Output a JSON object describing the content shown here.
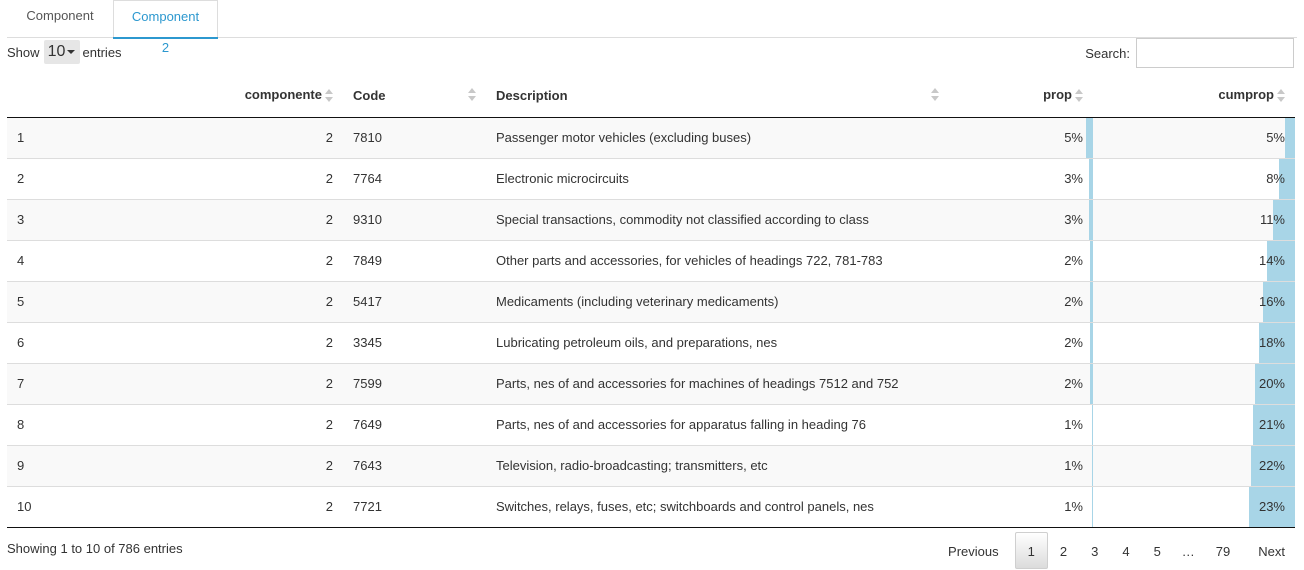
{
  "tabs": [
    {
      "label": "Component 1",
      "active": false
    },
    {
      "label": "Component 2",
      "active": true
    }
  ],
  "length": {
    "prefix": "Show",
    "value": "10",
    "suffix": "entries"
  },
  "search": {
    "label": "Search:",
    "value": "",
    "placeholder": ""
  },
  "table": {
    "headers": {
      "index": "",
      "componente": "componente",
      "code": "Code",
      "description": "Description",
      "prop": "prop",
      "cumprop": "cumprop"
    },
    "rows": [
      {
        "index": "1",
        "componente": "2",
        "code": "7810",
        "description": "Passenger motor vehicles (excluding buses)",
        "prop": "5%",
        "prop_fraction": 0.05,
        "cumprop": "5%",
        "cumprop_fraction": 0.05
      },
      {
        "index": "2",
        "componente": "2",
        "code": "7764",
        "description": "Electronic microcircuits",
        "prop": "3%",
        "prop_fraction": 0.03,
        "cumprop": "8%",
        "cumprop_fraction": 0.08
      },
      {
        "index": "3",
        "componente": "2",
        "code": "9310",
        "description": "Special transactions, commodity not classified according to class",
        "prop": "3%",
        "prop_fraction": 0.03,
        "cumprop": "11%",
        "cumprop_fraction": 0.11
      },
      {
        "index": "4",
        "componente": "2",
        "code": "7849",
        "description": "Other parts and accessories, for vehicles of headings 722, 781-783",
        "prop": "2%",
        "prop_fraction": 0.02,
        "cumprop": "14%",
        "cumprop_fraction": 0.14
      },
      {
        "index": "5",
        "componente": "2",
        "code": "5417",
        "description": "Medicaments (including veterinary medicaments)",
        "prop": "2%",
        "prop_fraction": 0.02,
        "cumprop": "16%",
        "cumprop_fraction": 0.16
      },
      {
        "index": "6",
        "componente": "2",
        "code": "3345",
        "description": "Lubricating petroleum oils, and preparations, nes",
        "prop": "2%",
        "prop_fraction": 0.02,
        "cumprop": "18%",
        "cumprop_fraction": 0.18
      },
      {
        "index": "7",
        "componente": "2",
        "code": "7599",
        "description": "Parts, nes of and accessories for machines of headings 7512 and 752",
        "prop": "2%",
        "prop_fraction": 0.02,
        "cumprop": "20%",
        "cumprop_fraction": 0.2
      },
      {
        "index": "8",
        "componente": "2",
        "code": "7649",
        "description": "Parts, nes of and accessories for apparatus falling in heading 76",
        "prop": "1%",
        "prop_fraction": 0.01,
        "cumprop": "21%",
        "cumprop_fraction": 0.21
      },
      {
        "index": "9",
        "componente": "2",
        "code": "7643",
        "description": "Television, radio-broadcasting; transmitters, etc",
        "prop": "1%",
        "prop_fraction": 0.01,
        "cumprop": "22%",
        "cumprop_fraction": 0.22
      },
      {
        "index": "10",
        "componente": "2",
        "code": "7721",
        "description": "Switches, relays, fuses, etc; switchboards and control panels, nes",
        "prop": "1%",
        "prop_fraction": 0.01,
        "cumprop": "23%",
        "cumprop_fraction": 0.23
      }
    ]
  },
  "info": "Showing 1 to 10 of 786 entries",
  "pagination": {
    "previous": "Previous",
    "next": "Next",
    "pages": [
      "1",
      "2",
      "3",
      "4",
      "5",
      "…",
      "79"
    ],
    "current": "1"
  },
  "colors": {
    "accent": "#2c98cf",
    "bar": "#a8d5e7"
  }
}
